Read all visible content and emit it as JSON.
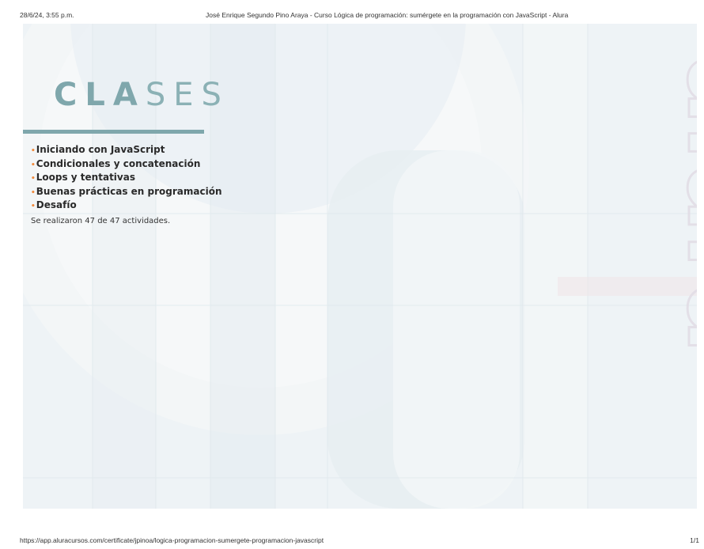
{
  "print_header": {
    "date": "28/6/24, 3:55 p.m.",
    "title": "José Enrique Segundo Pino Araya - Curso Lógica de programación: sumérgete en la programación con JavaScript - Alura"
  },
  "certificate": {
    "heading": {
      "part_strong": "CLA",
      "part_light": "SES"
    },
    "topics": [
      "Iniciando con JavaScript",
      "Condicionales y concatenación",
      "Loops y tentativas",
      "Buenas prácticas en programación",
      "Desafío"
    ],
    "bullet": "•",
    "activities_text": "Se realizaron 47 de 47 actividades.",
    "watermark_text": "alura",
    "colors": {
      "accent": "#7fa7ac",
      "bullet": "#f08a3c",
      "panel_bg": "#eef3f6"
    }
  },
  "print_footer": {
    "url": "https://app.aluracursos.com/certificate/jpinoa/logica-programacion-sumergete-programacion-javascript",
    "page": "1/1"
  }
}
